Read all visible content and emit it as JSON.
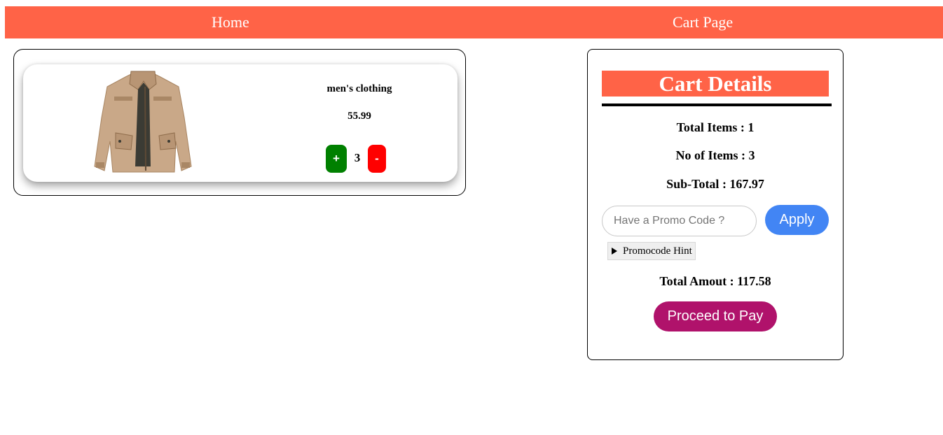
{
  "nav": {
    "home_label": "Home",
    "cart_label": "Cart Page"
  },
  "colors": {
    "accent": "#ff6347",
    "plus_button": "#008000",
    "minus_button": "#ff0000",
    "apply_button": "#4285f4",
    "proceed_button": "#b0126b"
  },
  "cart_items": [
    {
      "image_icon": "jacket-image",
      "category": "men's clothing",
      "price": "55.99",
      "plus_label": "+",
      "quantity": "3",
      "minus_label": "-"
    }
  ],
  "cart_details": {
    "title": "Cart Details",
    "total_items": "Total Items : 1",
    "no_of_items": "No of Items : 3",
    "sub_total": "Sub-Total : 167.97",
    "promo_placeholder": "Have a Promo Code ?",
    "apply_label": "Apply",
    "promo_hint_label": "Promocode Hint",
    "total_amount": "Total Amout : 117.58",
    "proceed_label": "Proceed to Pay"
  }
}
